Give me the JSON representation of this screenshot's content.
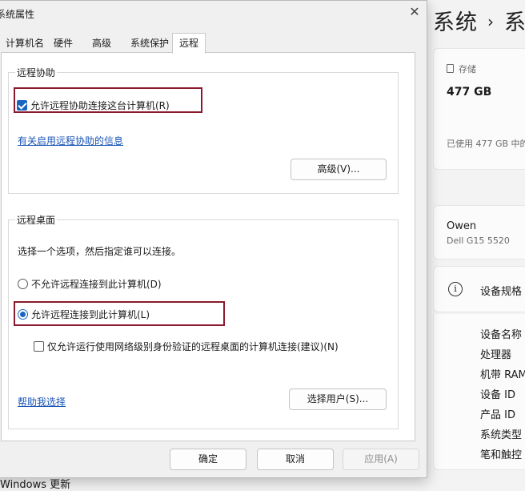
{
  "background": {
    "title": "系统",
    "title_sep": "›",
    "title_next": "系",
    "storage": {
      "label": "存储",
      "value": "477 GB",
      "used": "已使用 477 GB 中的"
    },
    "device": {
      "name": "Owen",
      "model": "Dell G15 5520"
    },
    "specs": {
      "heading": "设备规格",
      "items": [
        "设备名称",
        "处理器",
        "机带 RAM",
        "设备 ID",
        "产品 ID",
        "系统类型",
        "笔和触控"
      ]
    },
    "bottom_item": "Windows 更新"
  },
  "dialog": {
    "title": "系统属性",
    "close_glyph": "✕",
    "tabs": [
      {
        "label": "计算机名"
      },
      {
        "label": "硬件"
      },
      {
        "label": "高级"
      },
      {
        "label": "系统保护"
      },
      {
        "label": "远程"
      }
    ],
    "active_tab": "远程",
    "remote_assistance": {
      "legend": "远程协助",
      "allow_label": "允许远程协助连接这台计算机(R)",
      "allow_checked": true,
      "info_link": "有关启用远程协助的信息",
      "advanced_button": "高级(V)..."
    },
    "remote_desktop": {
      "legend": "远程桌面",
      "instruction": "选择一个选项，然后指定谁可以连接。",
      "option_disallow": "不允许远程连接到此计算机(D)",
      "option_allow": "允许远程连接到此计算机(L)",
      "selected_option": "allow",
      "nla_label": "仅允许运行使用网络级别身份验证的远程桌面的计算机连接(建议)(N)",
      "nla_checked": false,
      "help_link": "帮助我选择",
      "select_users_button": "选择用户(S)..."
    },
    "footer": {
      "ok": "确定",
      "cancel": "取消",
      "apply": "应用(A)"
    },
    "colors": {
      "accent": "#1a64c0",
      "highlight_box": "#8b1a2c",
      "link": "#1a55b8"
    }
  }
}
